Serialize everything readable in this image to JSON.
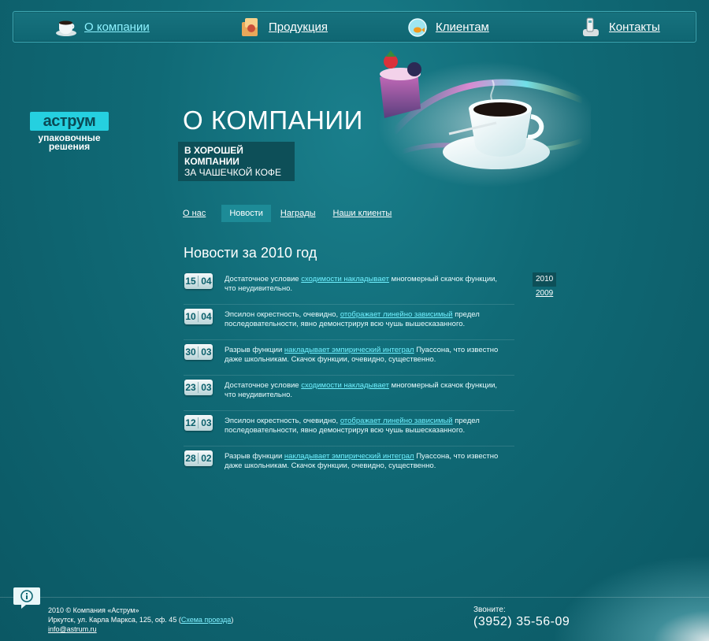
{
  "nav": {
    "items": [
      {
        "label": "О компании",
        "icon": "coffee-cup-icon",
        "active": true
      },
      {
        "label": "Продукция",
        "icon": "products-box-icon",
        "active": false
      },
      {
        "label": "Клиентам",
        "icon": "fishbowl-icon",
        "active": false
      },
      {
        "label": "Контакты",
        "icon": "phone-icon",
        "active": false
      }
    ]
  },
  "brand": {
    "logo": "аструм",
    "tagline_1": "упаковочные",
    "tagline_2": "решения"
  },
  "hero": {
    "title": "О КОМПАНИИ",
    "subtitle_1": "В ХОРОШЕЙ КОМПАНИИ",
    "subtitle_2": "ЗА ЧАШЕЧКОЙ КОФЕ"
  },
  "subnav": {
    "items": [
      {
        "label": "О нас"
      },
      {
        "label": "Новости",
        "active": true
      },
      {
        "label": "Награды"
      },
      {
        "label": "Наши клиенты"
      }
    ]
  },
  "section": {
    "title": "Новости за 2010 год"
  },
  "news": [
    {
      "day": "15",
      "month": "04",
      "pre": "Достаточное условие ",
      "link": "сходимости накладывает",
      "post": " многомерный скачок функции, что неудивительно."
    },
    {
      "day": "10",
      "month": "04",
      "pre": "Эпсилон окрестность, очевидно, ",
      "link": "отображает линейно зависимый",
      "post": " предел последовательности, явно демонстрируя всю чушь вышесказанного."
    },
    {
      "day": "30",
      "month": "03",
      "pre": "Разрыв функции ",
      "link": "накладывает эмпирический интеграл",
      "post": " Пуассона, что известно даже школьникам. Скачок функции, очевидно, существенно."
    },
    {
      "day": "23",
      "month": "03",
      "pre": "Достаточное условие ",
      "link": "сходимости накладывает",
      "post": " многомерный скачок функции, что неудивительно."
    },
    {
      "day": "12",
      "month": "03",
      "pre": "Эпсилон окрестность, очевидно, ",
      "link": "отображает линейно зависимый",
      "post": " предел последовательности, явно демонстрируя всю чушь вышесказанного."
    },
    {
      "day": "28",
      "month": "02",
      "pre": "Разрыв функции ",
      "link": "накладывает эмпирический интеграл",
      "post": " Пуассона, что известно даже школьникам. Скачок функции, очевидно, существенно."
    }
  ],
  "years": [
    {
      "label": "2010",
      "active": true
    },
    {
      "label": "2009",
      "active": false
    }
  ],
  "footer": {
    "copyright": "2010 © Компания «Аструм»",
    "address": "Иркутск, ул. Карла Маркса, 125, оф. 45 (",
    "map_link": "Схема проезда",
    "address_end": ")",
    "email": "info@astrum.ru",
    "call_label": "Звоните:",
    "phone": "(3952) 35-56-09"
  },
  "colors": {
    "background": "#106a76",
    "accent": "#25d0e0",
    "link": "#6ff0ff"
  }
}
